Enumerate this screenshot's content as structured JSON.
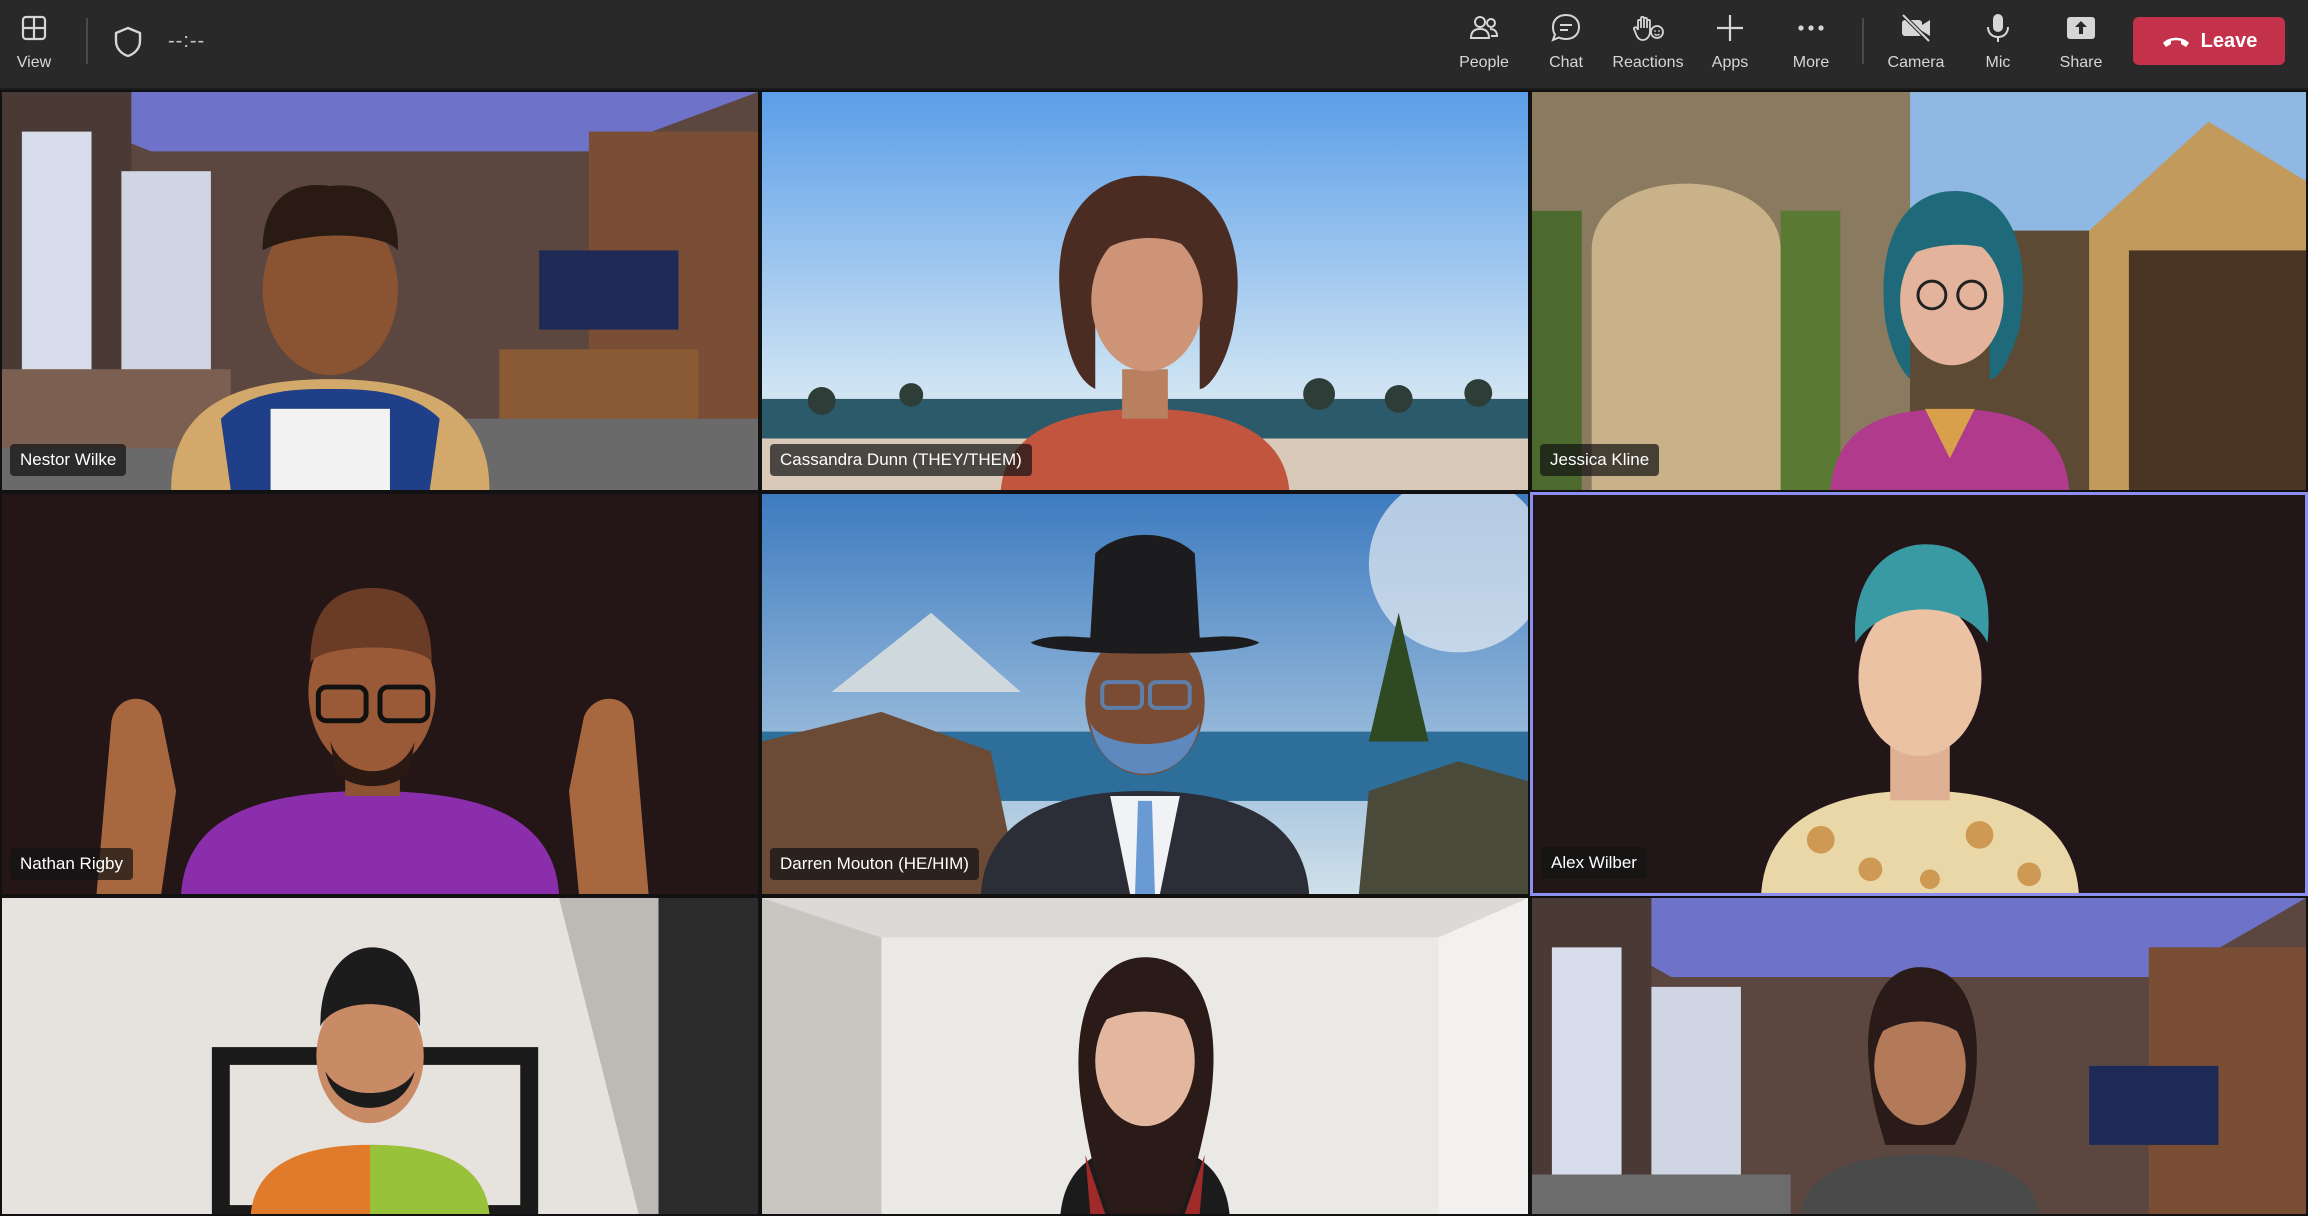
{
  "toolbar": {
    "view_label": "View",
    "timer": "--:--",
    "buttons": [
      {
        "label": "People",
        "icon": "people-icon"
      },
      {
        "label": "Chat",
        "icon": "chat-icon"
      },
      {
        "label": "Reactions",
        "icon": "reactions-icon"
      },
      {
        "label": "Apps",
        "icon": "plus-icon"
      },
      {
        "label": "More",
        "icon": "more-icon"
      },
      {
        "label": "Camera",
        "icon": "camera-off-icon"
      },
      {
        "label": "Mic",
        "icon": "mic-icon"
      },
      {
        "label": "Share",
        "icon": "share-icon"
      }
    ],
    "leave_label": "Leave",
    "leave_color": "#c4314b"
  },
  "participants": [
    {
      "name": "Nestor Wilke"
    },
    {
      "name": "Cassandra Dunn (THEY/THEM)"
    },
    {
      "name": "Jessica Kline"
    },
    {
      "name": "Nathan Rigby"
    },
    {
      "name": "Darren Mouton (HE/HIM)"
    },
    {
      "name": "Alex Wilber",
      "active_speaker": true
    },
    {
      "name": ""
    },
    {
      "name": ""
    },
    {
      "name": ""
    }
  ],
  "colors": {
    "toolbar_bg": "#292929",
    "active_border": "#8d8ff0"
  }
}
